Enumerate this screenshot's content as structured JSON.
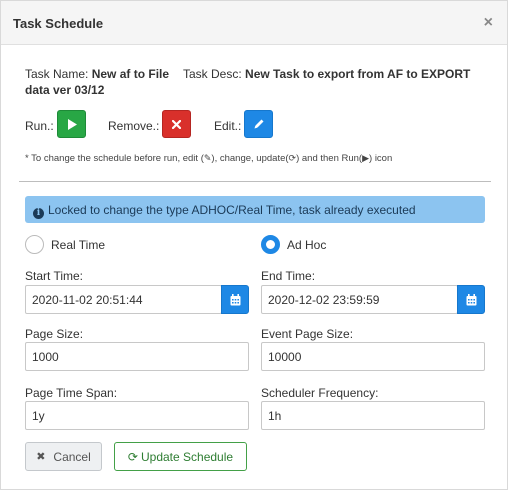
{
  "dialog": {
    "title": "Task Schedule",
    "close_glyph": "×"
  },
  "task": {
    "name_label": "Task Name:",
    "name_value": "New af to File data ver 03/12",
    "desc_label": "Task Desc:",
    "desc_value": "New Task to export from AF to EXPORT"
  },
  "actions": {
    "run_label": "Run.:",
    "remove_label": "Remove.:",
    "edit_label": "Edit.:",
    "run_icon": "play-icon",
    "remove_icon": "times-icon",
    "edit_icon": "pencil-icon"
  },
  "hint": {
    "part1": "* To change the schedule before run, edit (",
    "part2": "), change, update(",
    "part3": ") and then Run(",
    "part4": ") icon"
  },
  "banner": {
    "text": "Locked to change the type ADHOC/Real Time, task already executed",
    "icon": "info-circle-icon"
  },
  "schedule_type": {
    "options": [
      {
        "label": "Real Time",
        "checked": false
      },
      {
        "label": "Ad Hoc",
        "checked": true
      }
    ]
  },
  "fields": {
    "start_time": {
      "label": "Start Time:",
      "value": "2020-11-02 20:51:44"
    },
    "end_time": {
      "label": "End Time:",
      "value": "2020-12-02 23:59:59"
    },
    "page_size": {
      "label": "Page Size:",
      "value": "1000"
    },
    "event_page_size": {
      "label": "Event Page Size:",
      "value": "10000"
    },
    "page_time_span": {
      "label": "Page Time Span:",
      "value": "1y"
    },
    "scheduler_frequency": {
      "label": "Scheduler Frequency:",
      "value": "1h"
    }
  },
  "buttons": {
    "cancel": "Cancel",
    "update": "Update Schedule"
  },
  "colors": {
    "run": "#28a745",
    "remove": "#d9302b",
    "edit": "#1e88e5",
    "banner": "#8cc4f0",
    "update_border": "#43a047"
  }
}
